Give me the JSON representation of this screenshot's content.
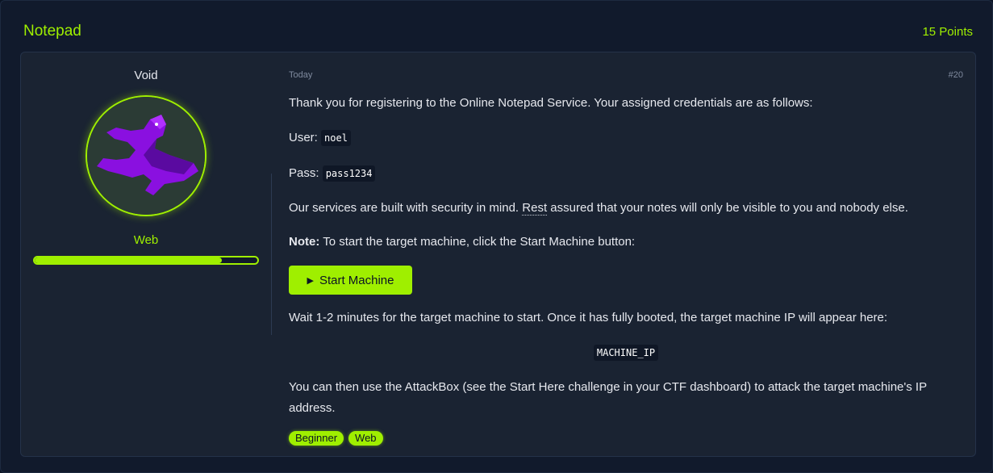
{
  "header": {
    "title": "Notepad",
    "points": "15 Points"
  },
  "author": {
    "name": "Void",
    "role": "Web",
    "progress_fraction": 0.84,
    "avatar_icon": "purple-figure-avatar"
  },
  "post": {
    "date": "Today",
    "number": "#20",
    "intro": "Thank you for registering to the Online Notepad Service. Your assigned credentials are as follows:",
    "user_label": "User:",
    "user_value": "noel",
    "pass_label": "Pass:",
    "pass_value": "pass1234",
    "security_pre": "Our services are built with security in mind.",
    "security_word": "Rest",
    "security_post": "assured that your notes will only be visible to you and nobody else.",
    "note_label": "Note:",
    "note_text": "To start the target machine, click the Start Machine button:",
    "start_button": "Start Machine",
    "wait_text": "Wait 1-2 minutes for the target machine to start. Once it has fully booted, the target machine IP will appear here:",
    "machine_ip": "MACHINE_IP",
    "attack_text": "You can then use the AttackBox (see the Start Here challenge in your CTF dashboard) to attack the target machine's IP address."
  },
  "tags": [
    "Beginner",
    "Web"
  ],
  "colors": {
    "accent": "#9fef00",
    "background": "#111a2c",
    "card": "#1a2332"
  }
}
